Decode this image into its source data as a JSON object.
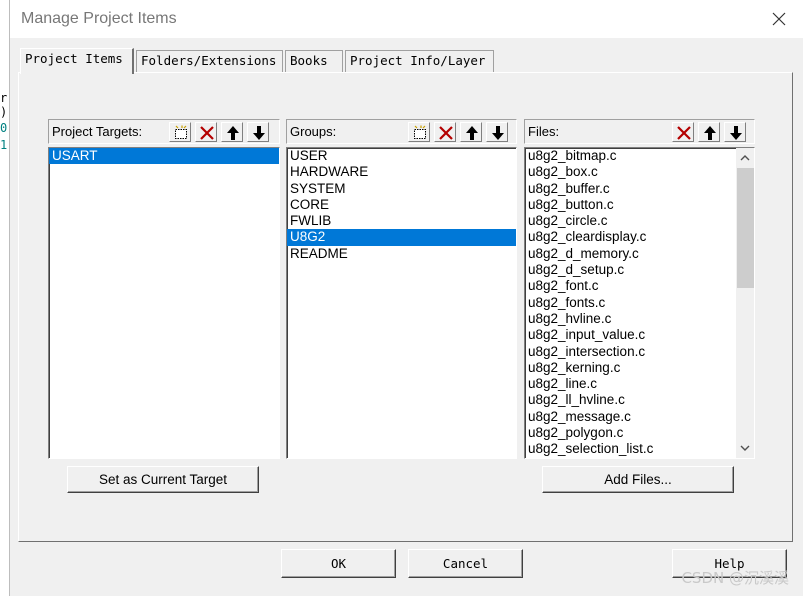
{
  "background_text": {
    "lines": [
      "r",
      ")",
      "0",
      "1"
    ]
  },
  "window": {
    "title": "Manage Project Items",
    "close_icon": "close-icon"
  },
  "tabs": [
    {
      "label": "Project Items",
      "active": true
    },
    {
      "label": "Folders/Extensions",
      "active": false
    },
    {
      "label": "Books",
      "active": false
    },
    {
      "label": "Project Info/Layer",
      "active": false
    }
  ],
  "targets": {
    "label": "Project Targets:",
    "items": [
      {
        "text": "USART",
        "selected": true
      }
    ]
  },
  "groups": {
    "label": "Groups:",
    "items": [
      {
        "text": "USER",
        "selected": false
      },
      {
        "text": "HARDWARE",
        "selected": false
      },
      {
        "text": "SYSTEM",
        "selected": false
      },
      {
        "text": "CORE",
        "selected": false
      },
      {
        "text": "FWLIB",
        "selected": false
      },
      {
        "text": "U8G2",
        "selected": true
      },
      {
        "text": "README",
        "selected": false
      }
    ]
  },
  "files": {
    "label": "Files:",
    "items": [
      "u8g2_bitmap.c",
      "u8g2_box.c",
      "u8g2_buffer.c",
      "u8g2_button.c",
      "u8g2_circle.c",
      "u8g2_cleardisplay.c",
      "u8g2_d_memory.c",
      "u8g2_d_setup.c",
      "u8g2_font.c",
      "u8g2_fonts.c",
      "u8g2_hvline.c",
      "u8g2_input_value.c",
      "u8g2_intersection.c",
      "u8g2_kerning.c",
      "u8g2_line.c",
      "u8g2_ll_hvline.c",
      "u8g2_message.c",
      "u8g2_polygon.c",
      "u8g2_selection_list.c"
    ]
  },
  "buttons": {
    "set_current_target": "Set as Current Target",
    "add_files": "Add Files...",
    "ok": "OK",
    "cancel": "Cancel",
    "help": "Help"
  },
  "watermark": "CSDN @沉溪溪",
  "colors": {
    "selection": "#0078d7",
    "delete_icon": "#b40000",
    "dialog_bg": "#f0f0f0"
  }
}
